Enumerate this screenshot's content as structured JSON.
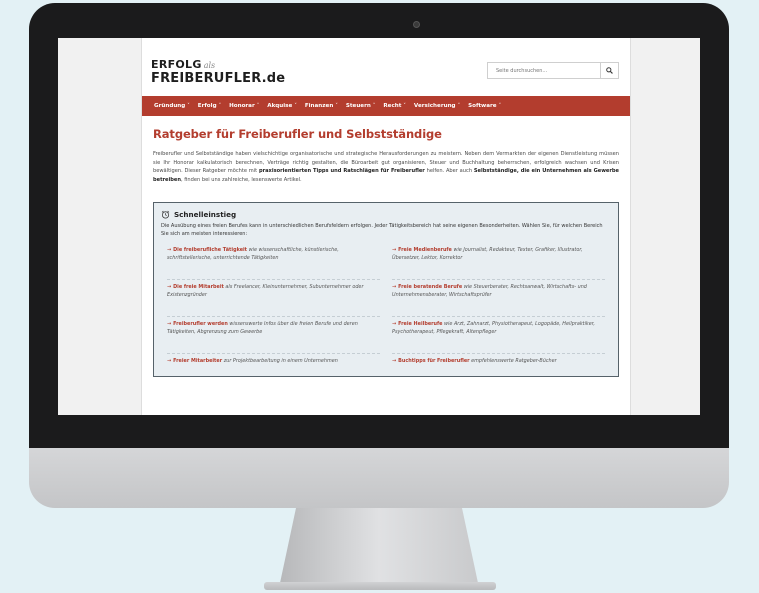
{
  "site": {
    "logo": {
      "line1": "ERFOLG",
      "als": "als",
      "line2": "FREIBERUFLER.de"
    },
    "search": {
      "placeholder": "Seite durchsuchen..."
    }
  },
  "nav": {
    "items": [
      {
        "label": "Gründung"
      },
      {
        "label": "Erfolg"
      },
      {
        "label": "Honorar"
      },
      {
        "label": "Akquise"
      },
      {
        "label": "Finanzen"
      },
      {
        "label": "Steuern"
      },
      {
        "label": "Recht"
      },
      {
        "label": "Versicherung"
      },
      {
        "label": "Software"
      }
    ],
    "caret": "˅"
  },
  "main": {
    "title": "Ratgeber für Freiberufler und Selbstständige",
    "intro": {
      "p1": "Freiberufler und Selbstständige haben vielschichtige organisatorische und strategische Herausforderungen zu meistern. Neben dem Vermarkten der eigenen Dienstleistung müssen sie Ihr Honorar kalkulatorisch berechnen, Verträge richtig gestalten, die Büroarbeit gut organisieren, Steuer und Buchhaltung beherrschen, erfolgreich wachsen und Krisen bewältigen. Dieser Ratgeber möchte mit ",
      "bold1": "praxisorientierten Tipps und Ratschlägen für Freiberufler",
      "p2": " helfen. Aber auch ",
      "bold2": "Selbstständige, die ein Unternehmen als Gewerbe betreiben",
      "p3": ", finden bei uns zahlreiche, lesenswerte Artikel."
    }
  },
  "quickstart": {
    "title": "Schnelleinstieg",
    "description": "Die Ausübung eines freien Berufes kann in unterschiedlichen Berufsfeldern erfolgen. Jeder Tätigkeitsbereich hat seine eigenen Besonderheiten. Wählen Sie, für welchen Bereich Sie sich am meisten interessieren:",
    "arrow": "→",
    "items": [
      {
        "link": "Die freiberufliche Tätigkeit",
        "rest": " wie wissenschaftliche, künstlerische, schriftstellerische, unterrichtende Tätigkeiten"
      },
      {
        "link": "Freie Medienberufe",
        "rest": " wie Journalist, Redakteur, Texter, Grafiker, Illustrator, Übersetzer, Lektor, Korrektor"
      },
      {
        "link": "Die freie Mitarbeit",
        "rest": " als Freelancer, Kleinunternehmer, Subunternehmer oder Existenzgründer"
      },
      {
        "link": "Freie beratende Berufe",
        "rest": " wie Steuerberater, Rechtsanwalt, Wirtschafts- und Unternehmensberater, Wirtschaftsprüfer"
      },
      {
        "link": "Freiberufler werden",
        "rest": " wissenswerte Infos über die freien Berufe und deren Tätigkeiten, Abgrenzung zum Gewerbe"
      },
      {
        "link": "Freie Heilberufe",
        "rest": " wie Arzt, Zahnarzt, Physiotherapeut, Logopäde, Heilpraktiker, Psychotherapeut, Pflegekraft, Altenpfleger"
      },
      {
        "link": "Freier Mitarbeiter",
        "rest": " zur Projektbearbeitung in einem Unternehmen"
      },
      {
        "link": "Buchtipps für Freiberufler",
        "rest": " empfehlenswerte Ratgeber-Bücher"
      }
    ]
  },
  "colors": {
    "accent": "#b33d2e",
    "bezel": "#1b1b1c",
    "background": "#e3f1f5",
    "quickstart_bg": "#e8eef2"
  }
}
